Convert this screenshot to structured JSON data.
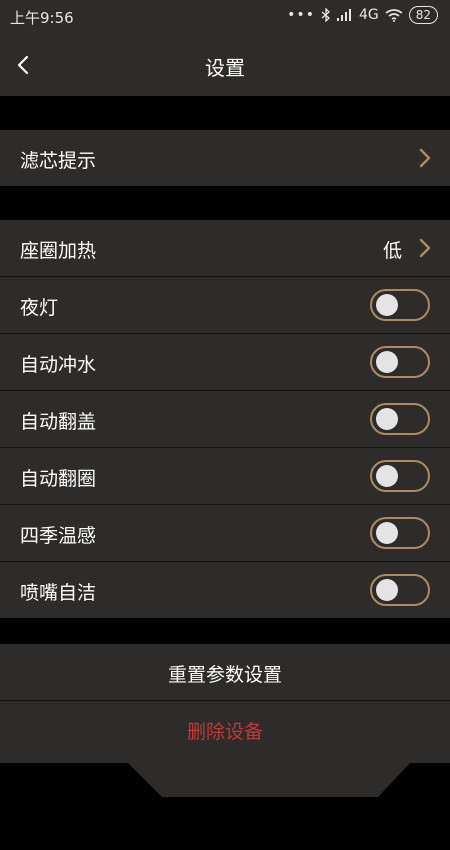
{
  "status_bar": {
    "time": "上午9:56",
    "dots": "•••",
    "network": "4G",
    "battery": "82"
  },
  "header": {
    "title": "设置"
  },
  "sections": {
    "filter": {
      "label": "滤芯提示"
    },
    "seat_heat": {
      "label": "座圈加热",
      "value": "低"
    },
    "toggles": [
      {
        "label": "夜灯",
        "on": false
      },
      {
        "label": "自动冲水",
        "on": false
      },
      {
        "label": "自动翻盖",
        "on": false
      },
      {
        "label": "自动翻圈",
        "on": false
      },
      {
        "label": "四季温感",
        "on": false
      },
      {
        "label": "喷嘴自洁",
        "on": false
      }
    ]
  },
  "actions": {
    "reset_label": "重置参数设置",
    "delete_label": "删除设备"
  },
  "colors": {
    "accent": "#b08a5c",
    "danger": "#c33838",
    "row_bg": "#2e2c2b",
    "page_bg": "#000000"
  }
}
